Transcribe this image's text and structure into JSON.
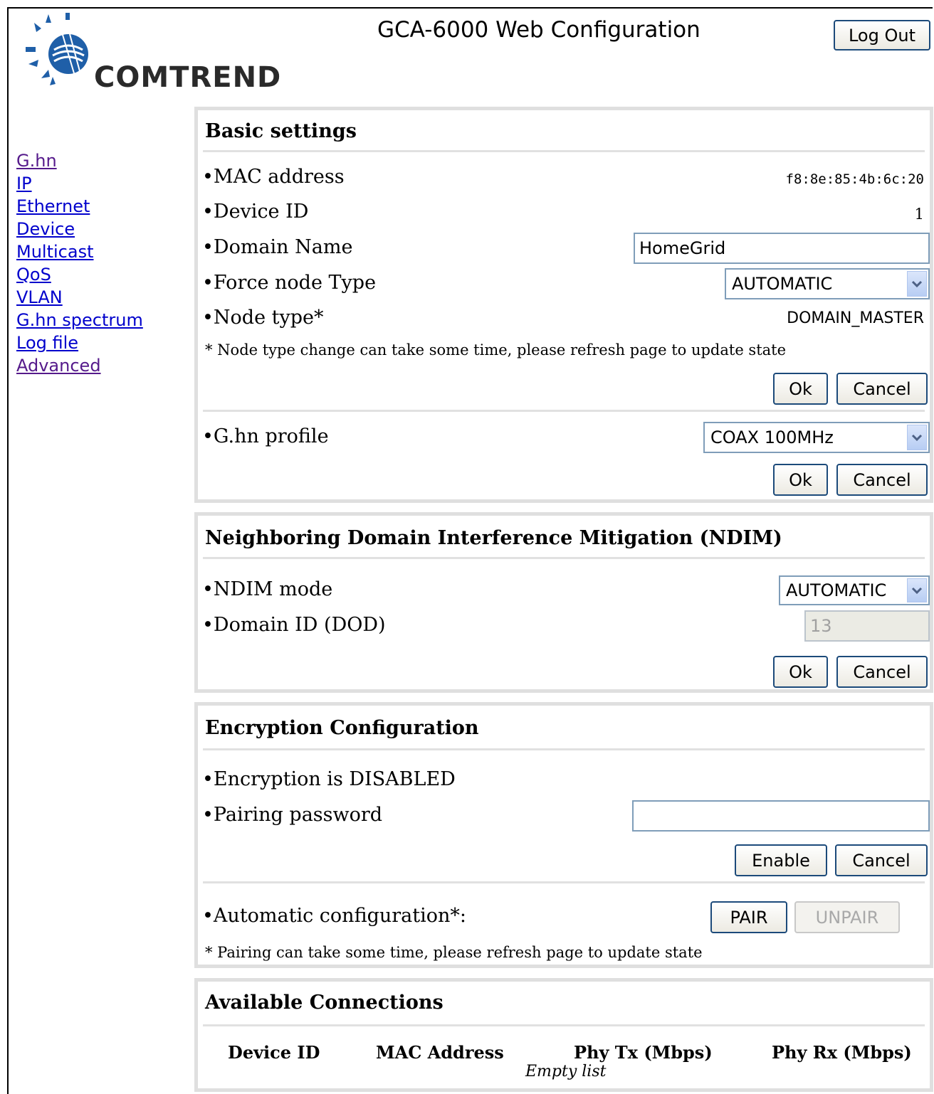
{
  "header": {
    "brand": "COMTREND",
    "title": "GCA-6000 Web Configuration",
    "logout_label": "Log Out"
  },
  "sidebar": {
    "items": [
      {
        "label": "G.hn",
        "visited": true
      },
      {
        "label": "IP",
        "visited": false
      },
      {
        "label": "Ethernet",
        "visited": false
      },
      {
        "label": "Device",
        "visited": false
      },
      {
        "label": "Multicast",
        "visited": false
      },
      {
        "label": "QoS",
        "visited": false
      },
      {
        "label": "VLAN",
        "visited": false
      },
      {
        "label": "G.hn spectrum",
        "visited": false
      },
      {
        "label": "Log file",
        "visited": false
      },
      {
        "label": "Advanced",
        "visited": true
      }
    ]
  },
  "basic": {
    "title": "Basic settings",
    "mac_label": "•MAC address",
    "mac_value": "f8:8e:85:4b:6c:20",
    "device_id_label": "•Device ID",
    "device_id_value": "1",
    "domain_name_label": "•Domain Name",
    "domain_name_value": "HomeGrid",
    "force_node_label": "•Force node Type",
    "force_node_value": "AUTOMATIC",
    "node_type_label": "•Node type*",
    "node_type_value": "DOMAIN_MASTER",
    "note": "* Node type change can take some time, please refresh page to update state",
    "ok_label": "Ok",
    "cancel_label": "Cancel",
    "profile_label": "•G.hn profile",
    "profile_value": "COAX 100MHz",
    "ok2_label": "Ok",
    "cancel2_label": "Cancel"
  },
  "ndim": {
    "title": "Neighboring Domain Interference Mitigation (NDIM)",
    "mode_label": "•NDIM mode",
    "mode_value": "AUTOMATIC",
    "domain_id_label": "•Domain ID (DOD)",
    "domain_id_value": "13",
    "ok_label": "Ok",
    "cancel_label": "Cancel"
  },
  "encryption": {
    "title": "Encryption Configuration",
    "status": "•Encryption is DISABLED",
    "pairing_label": "•Pairing password",
    "pairing_value": "",
    "enable_label": "Enable",
    "cancel_label": "Cancel",
    "auto_label": "•Automatic configuration*:",
    "pair_label": "PAIR",
    "unpair_label": "UNPAIR",
    "note": "* Pairing can take some time, please refresh page to update state"
  },
  "connections": {
    "title": "Available Connections",
    "columns": [
      "Device ID",
      "MAC Address",
      "Phy Tx (Mbps)",
      "Phy Rx (Mbps)"
    ],
    "empty_text": "Empty list"
  },
  "colors": {
    "link": "#0000cc",
    "visited_link": "#551a8b",
    "button_border": "#1c4a7a",
    "panel_border": "#dfdfdf"
  }
}
